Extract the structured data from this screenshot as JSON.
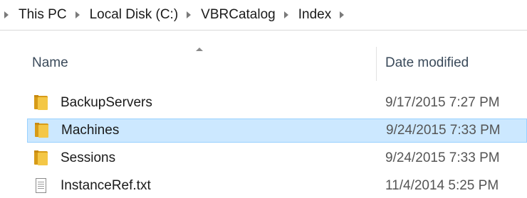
{
  "breadcrumb": {
    "items": [
      "This PC",
      "Local Disk (C:)",
      "VBRCatalog",
      "Index"
    ]
  },
  "columns": {
    "name": "Name",
    "date": "Date modified"
  },
  "files": [
    {
      "name": "BackupServers",
      "date": "9/17/2015 7:27 PM",
      "icon": "folder-icon",
      "selected": false
    },
    {
      "name": "Machines",
      "date": "9/24/2015 7:33 PM",
      "icon": "folder-icon",
      "selected": true
    },
    {
      "name": "Sessions",
      "date": "9/24/2015 7:33 PM",
      "icon": "folder-icon",
      "selected": false
    },
    {
      "name": "InstanceRef.txt",
      "date": "11/4/2014 5:25 PM",
      "icon": "text-file-icon",
      "selected": false
    }
  ],
  "colors": {
    "selection_fill": "#cce8ff",
    "selection_border": "#99d1ff",
    "folder": "#f4c746"
  }
}
